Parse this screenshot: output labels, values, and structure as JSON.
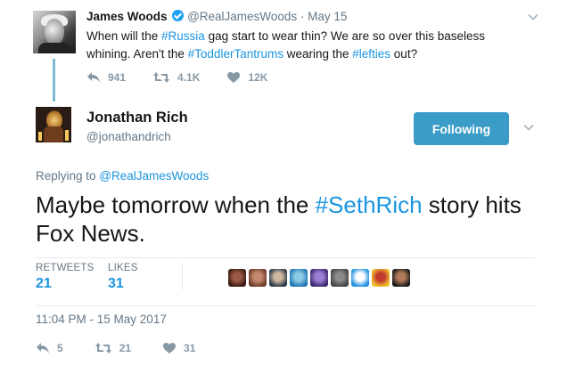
{
  "parent_tweet": {
    "author_name": "James Woods",
    "verified_icon": "verified-badge-icon",
    "handle": "@RealJamesWoods",
    "separator": "·",
    "date": "May 15",
    "text_parts": [
      "When will the ",
      "#Russia",
      " gag start to wear thin? We are so over this baseless whining. Aren't the ",
      "#ToddlerTantrums",
      " wearing the ",
      "#lefties",
      " out?"
    ],
    "actions": {
      "reply_count": "941",
      "retweet_count": "4.1K",
      "like_count": "12K"
    }
  },
  "main_tweet": {
    "author_name": "Jonathan Rich",
    "handle": "@jonathandrich",
    "follow_button_label": "Following",
    "replying_prefix": "Replying to ",
    "replying_mention": "@RealJamesWoods",
    "text_parts": [
      "Maybe tomorrow when the ",
      "#SethRich",
      " story hits Fox News."
    ],
    "stats": {
      "retweets_label": "RETWEETS",
      "retweets_value": "21",
      "likes_label": "LIKES",
      "likes_value": "31"
    },
    "liker_avatars": [
      {
        "name": "liker-avatar-1",
        "color_a": "#3b1a12",
        "color_b": "#9b5a45"
      },
      {
        "name": "liker-avatar-2",
        "color_a": "#6e3b2a",
        "color_b": "#c48a6e"
      },
      {
        "name": "liker-avatar-3",
        "color_a": "#2b3a4a",
        "color_b": "#d0b8a0"
      },
      {
        "name": "liker-avatar-4",
        "color_a": "#1f78b4",
        "color_b": "#8ecae6"
      },
      {
        "name": "liker-avatar-5",
        "color_a": "#3d2a6e",
        "color_b": "#9b7fd4"
      },
      {
        "name": "liker-avatar-6",
        "color_a": "#444444",
        "color_b": "#8a8a8a"
      },
      {
        "name": "liker-avatar-7",
        "color_a": "#1d8fe0",
        "color_b": "#ffffff"
      },
      {
        "name": "liker-avatar-8",
        "color_a": "#f2c230",
        "color_b": "#c0392b"
      },
      {
        "name": "liker-avatar-9",
        "color_a": "#1a1a1a",
        "color_b": "#b07a5a"
      }
    ],
    "timestamp": "11:04 PM - 15 May 2017",
    "actions": {
      "reply_count": "5",
      "retweet_count": "21",
      "like_count": "31"
    }
  },
  "colors": {
    "link": "#1b95e0",
    "follow_button": "#3a9cc7",
    "thread_line": "#7fb8d4",
    "muted": "#657786"
  }
}
